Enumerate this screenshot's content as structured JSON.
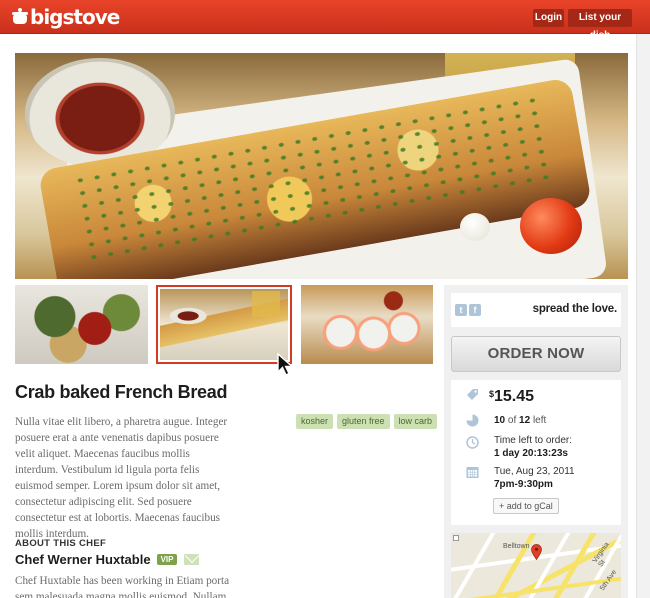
{
  "header": {
    "brand": "bigstove",
    "login_label": "Login",
    "list_dish_label": "List your dish",
    "brand_color": "#d7381f"
  },
  "dish": {
    "title": "Crab baked French Bread",
    "description": "Nulla vitae elit libero, a pharetra augue. Integer posuere erat a ante venenatis dapibus posuere velit aliquet. Maecenas faucibus mollis interdum. Vestibulum id ligula porta felis euismod semper. Lorem ipsum dolor sit amet, consectetur adipiscing elit. Sed posuere consectetur est at lobortis. Maecenas faucibus mollis interdum.",
    "tags": [
      "kosher",
      "gluten free",
      "low carb"
    ]
  },
  "chef": {
    "section_heading": "ABOUT THIS CHEF",
    "name": "Chef Werner Huxtable",
    "badge": "VIP",
    "bio": "Chef Huxtable has been working in Etiam porta sem malesuada magna mollis euismod. Nullam"
  },
  "sidebar": {
    "share_text": "spread the love.",
    "twitter_icon": "twitter-icon",
    "facebook_icon": "facebook-icon",
    "order_label": "ORDER NOW",
    "price_currency": "$",
    "price": "15.45",
    "count_taken": "10",
    "count_of": "of",
    "count_total": "12",
    "count_suffix": "left",
    "time_left_label": "Time left to order:",
    "time_left_value": "1 day 20:13:23s",
    "date": "Tue, Aug 23, 2011",
    "time_range": "7pm-9:30pm",
    "gcal_label": "+ add to gCal"
  },
  "map": {
    "labels": [
      "Belltown",
      "Virginia St",
      "5th Ave"
    ]
  },
  "thumbnails": {
    "selected_index": 1
  }
}
